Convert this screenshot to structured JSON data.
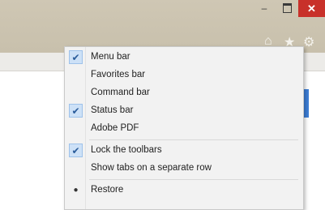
{
  "window": {
    "minimize_glyph": "–",
    "close_glyph": "✕",
    "icons": [
      "home-icon",
      "star-icon",
      "gear-icon"
    ]
  },
  "colors": {
    "close": "#c8312a",
    "accent": "#3c7ed6",
    "menu_bg": "#f2f2f2"
  },
  "menu": {
    "items": [
      {
        "label": "Menu bar",
        "checked": true
      },
      {
        "label": "Favorites bar",
        "checked": false
      },
      {
        "label": "Command bar",
        "checked": false
      },
      {
        "label": "Status bar",
        "checked": true
      },
      {
        "label": "Adobe PDF",
        "checked": false
      },
      {
        "label": "Lock the toolbars",
        "checked": true
      },
      {
        "label": "Show tabs on a separate row",
        "checked": false
      },
      {
        "label": "Restore",
        "selected": true
      }
    ]
  }
}
